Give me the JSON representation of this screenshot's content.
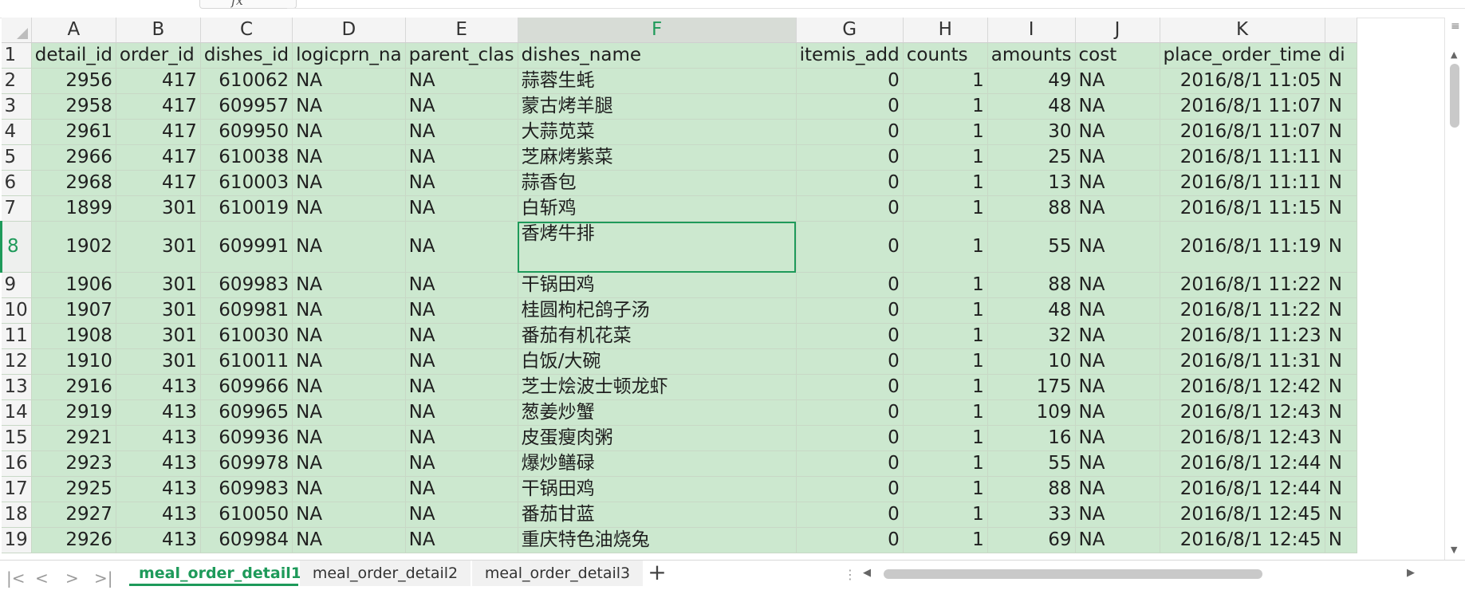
{
  "formula_bar": {
    "fx_label": "fx"
  },
  "columns": {
    "letters": [
      "A",
      "B",
      "C",
      "D",
      "E",
      "F",
      "G",
      "H",
      "I",
      "J",
      "K",
      ""
    ],
    "selected": "F",
    "headers": [
      "detail_id",
      "order_id",
      "dishes_id",
      "logicprn_na",
      "parent_clas",
      "dishes_name",
      "itemis_add",
      "counts",
      "amounts",
      "cost",
      "place_order_time",
      "di"
    ]
  },
  "selected_row": "8",
  "rows": [
    {
      "n": "2",
      "detail_id": "2956",
      "order_id": "417",
      "dishes_id": "610062",
      "logicprn": "NA",
      "parent": "NA",
      "dishes_name": "蒜蓉生蚝",
      "itemis_add": "0",
      "counts": "1",
      "amounts": "49",
      "cost": "NA",
      "time": "2016/8/1 11:05",
      "extra": "N"
    },
    {
      "n": "3",
      "detail_id": "2958",
      "order_id": "417",
      "dishes_id": "609957",
      "logicprn": "NA",
      "parent": "NA",
      "dishes_name": "蒙古烤羊腿",
      "itemis_add": "0",
      "counts": "1",
      "amounts": "48",
      "cost": "NA",
      "time": "2016/8/1 11:07",
      "extra": "N"
    },
    {
      "n": "4",
      "detail_id": "2961",
      "order_id": "417",
      "dishes_id": "609950",
      "logicprn": "NA",
      "parent": "NA",
      "dishes_name": "大蒜苋菜",
      "itemis_add": "0",
      "counts": "1",
      "amounts": "30",
      "cost": "NA",
      "time": "2016/8/1 11:07",
      "extra": "N"
    },
    {
      "n": "5",
      "detail_id": "2966",
      "order_id": "417",
      "dishes_id": "610038",
      "logicprn": "NA",
      "parent": "NA",
      "dishes_name": "芝麻烤紫菜",
      "itemis_add": "0",
      "counts": "1",
      "amounts": "25",
      "cost": "NA",
      "time": "2016/8/1 11:11",
      "extra": "N"
    },
    {
      "n": "6",
      "detail_id": "2968",
      "order_id": "417",
      "dishes_id": "610003",
      "logicprn": "NA",
      "parent": "NA",
      "dishes_name": "蒜香包",
      "itemis_add": "0",
      "counts": "1",
      "amounts": "13",
      "cost": "NA",
      "time": "2016/8/1 11:11",
      "extra": "N"
    },
    {
      "n": "7",
      "detail_id": "1899",
      "order_id": "301",
      "dishes_id": "610019",
      "logicprn": "NA",
      "parent": "NA",
      "dishes_name": "白斩鸡",
      "itemis_add": "0",
      "counts": "1",
      "amounts": "88",
      "cost": "NA",
      "time": "2016/8/1 11:15",
      "extra": "N"
    },
    {
      "n": "8",
      "detail_id": "1902",
      "order_id": "301",
      "dishes_id": "609991",
      "logicprn": "NA",
      "parent": "NA",
      "dishes_name": "香烤牛排",
      "itemis_add": "0",
      "counts": "1",
      "amounts": "55",
      "cost": "NA",
      "time": "2016/8/1 11:19",
      "extra": "N"
    },
    {
      "n": "9",
      "detail_id": "1906",
      "order_id": "301",
      "dishes_id": "609983",
      "logicprn": "NA",
      "parent": "NA",
      "dishes_name": "干锅田鸡",
      "itemis_add": "0",
      "counts": "1",
      "amounts": "88",
      "cost": "NA",
      "time": "2016/8/1 11:22",
      "extra": "N"
    },
    {
      "n": "10",
      "detail_id": "1907",
      "order_id": "301",
      "dishes_id": "609981",
      "logicprn": "NA",
      "parent": "NA",
      "dishes_name": "桂圆枸杞鸽子汤",
      "itemis_add": "0",
      "counts": "1",
      "amounts": "48",
      "cost": "NA",
      "time": "2016/8/1 11:22",
      "extra": "N"
    },
    {
      "n": "11",
      "detail_id": "1908",
      "order_id": "301",
      "dishes_id": "610030",
      "logicprn": "NA",
      "parent": "NA",
      "dishes_name": "番茄有机花菜",
      "itemis_add": "0",
      "counts": "1",
      "amounts": "32",
      "cost": "NA",
      "time": "2016/8/1 11:23",
      "extra": "N"
    },
    {
      "n": "12",
      "detail_id": "1910",
      "order_id": "301",
      "dishes_id": "610011",
      "logicprn": "NA",
      "parent": "NA",
      "dishes_name": "白饭/大碗",
      "itemis_add": "0",
      "counts": "1",
      "amounts": "10",
      "cost": "NA",
      "time": "2016/8/1 11:31",
      "extra": "N"
    },
    {
      "n": "13",
      "detail_id": "2916",
      "order_id": "413",
      "dishes_id": "609966",
      "logicprn": "NA",
      "parent": "NA",
      "dishes_name": "芝士烩波士顿龙虾",
      "itemis_add": "0",
      "counts": "1",
      "amounts": "175",
      "cost": "NA",
      "time": "2016/8/1 12:42",
      "extra": "N"
    },
    {
      "n": "14",
      "detail_id": "2919",
      "order_id": "413",
      "dishes_id": "609965",
      "logicprn": "NA",
      "parent": "NA",
      "dishes_name": "葱姜炒蟹",
      "itemis_add": "0",
      "counts": "1",
      "amounts": "109",
      "cost": "NA",
      "time": "2016/8/1 12:43",
      "extra": "N"
    },
    {
      "n": "15",
      "detail_id": "2921",
      "order_id": "413",
      "dishes_id": "609936",
      "logicprn": "NA",
      "parent": "NA",
      "dishes_name": "皮蛋瘦肉粥",
      "itemis_add": "0",
      "counts": "1",
      "amounts": "16",
      "cost": "NA",
      "time": "2016/8/1 12:43",
      "extra": "N"
    },
    {
      "n": "16",
      "detail_id": "2923",
      "order_id": "413",
      "dishes_id": "609978",
      "logicprn": "NA",
      "parent": "NA",
      "dishes_name": "爆炒鳝碌",
      "itemis_add": "0",
      "counts": "1",
      "amounts": "55",
      "cost": "NA",
      "time": "2016/8/1 12:44",
      "extra": "N"
    },
    {
      "n": "17",
      "detail_id": "2925",
      "order_id": "413",
      "dishes_id": "609983",
      "logicprn": "NA",
      "parent": "NA",
      "dishes_name": "干锅田鸡",
      "itemis_add": "0",
      "counts": "1",
      "amounts": "88",
      "cost": "NA",
      "time": "2016/8/1 12:44",
      "extra": "N"
    },
    {
      "n": "18",
      "detail_id": "2927",
      "order_id": "413",
      "dishes_id": "610050",
      "logicprn": "NA",
      "parent": "NA",
      "dishes_name": "番茄甘蓝",
      "itemis_add": "0",
      "counts": "1",
      "amounts": "33",
      "cost": "NA",
      "time": "2016/8/1 12:45",
      "extra": "N"
    },
    {
      "n": "19",
      "detail_id": "2926",
      "order_id": "413",
      "dishes_id": "609984",
      "logicprn": "NA",
      "parent": "NA",
      "dishes_name": "重庆特色油烧兔",
      "itemis_add": "0",
      "counts": "1",
      "amounts": "69",
      "cost": "NA",
      "time": "2016/8/1 12:45",
      "extra": "N"
    }
  ],
  "sheet_tabs": [
    {
      "label": "meal_order_detail1",
      "active": true
    },
    {
      "label": "meal_order_detail2",
      "active": false
    },
    {
      "label": "meal_order_detail3",
      "active": false
    }
  ],
  "tabbar": {
    "add_tab_label": "+"
  },
  "colors": {
    "accent": "#1e9a5a",
    "cell_fill": "#cce8cf"
  }
}
